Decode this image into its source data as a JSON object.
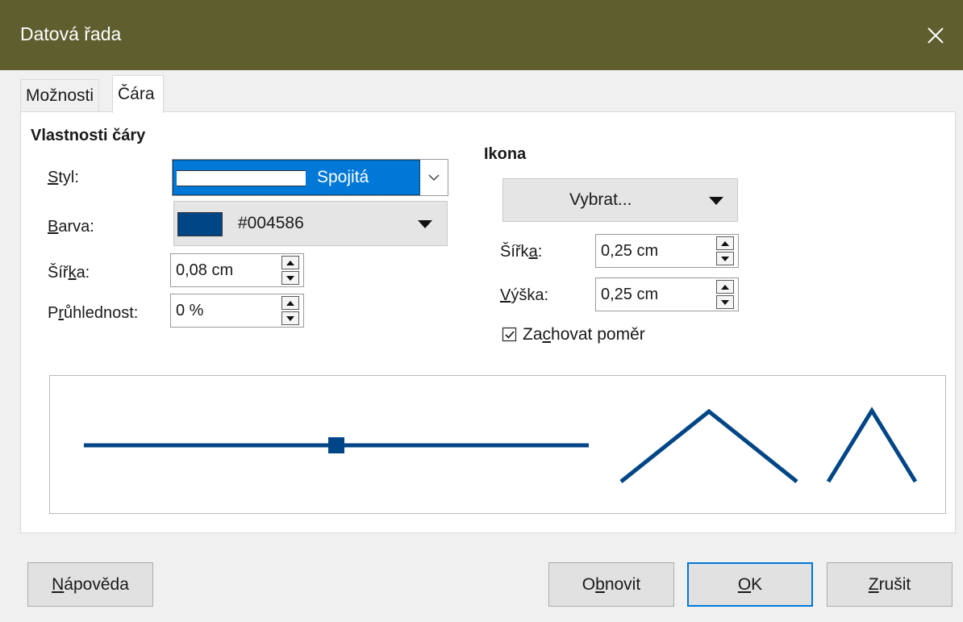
{
  "window": {
    "title": "Datová řada",
    "close_icon": "close-icon"
  },
  "tabs": [
    {
      "label": "Možnosti"
    },
    {
      "label": "Čára"
    }
  ],
  "line_properties": {
    "title": "Vlastnosti čáry",
    "style": {
      "label_u": "S",
      "label_rest": "tyl:",
      "value": "Spojitá"
    },
    "color": {
      "label_u": "B",
      "label_rest": "arva:",
      "value": "#004586",
      "swatch": "#004586"
    },
    "width": {
      "label_pre": "Šíř",
      "label_u": "k",
      "label_post": "a:",
      "value": "0,08 cm"
    },
    "transparency": {
      "label_pre": "P",
      "label_u": "r",
      "label_post": "ůhlednost:",
      "value": "0 %"
    }
  },
  "icon": {
    "title": "Ikona",
    "select_label": "Vybrat...",
    "width": {
      "label_pre": "Šířk",
      "label_u": "a",
      "label_post": ":",
      "value": "0,25 cm"
    },
    "height": {
      "label_u": "V",
      "label_rest": "ýška:",
      "value": "0,25 cm"
    },
    "keep_ratio": {
      "label_pre": "Za",
      "label_u": "c",
      "label_post": "hovat poměr",
      "checked": true
    }
  },
  "preview": {
    "line_color": "#004586"
  },
  "buttons": {
    "help": {
      "label_u": "N",
      "label_rest": "ápověda"
    },
    "reset": {
      "label_pre": "O",
      "label_u": "b",
      "label_post": "novit"
    },
    "ok": {
      "label_u": "O",
      "label_rest": "K"
    },
    "cancel": {
      "label_u": "Z",
      "label_rest": "rušit"
    }
  },
  "colors": {
    "titlebar": "#5e5e2f",
    "accent": "#0078d7",
    "selection": "#0078d7"
  }
}
